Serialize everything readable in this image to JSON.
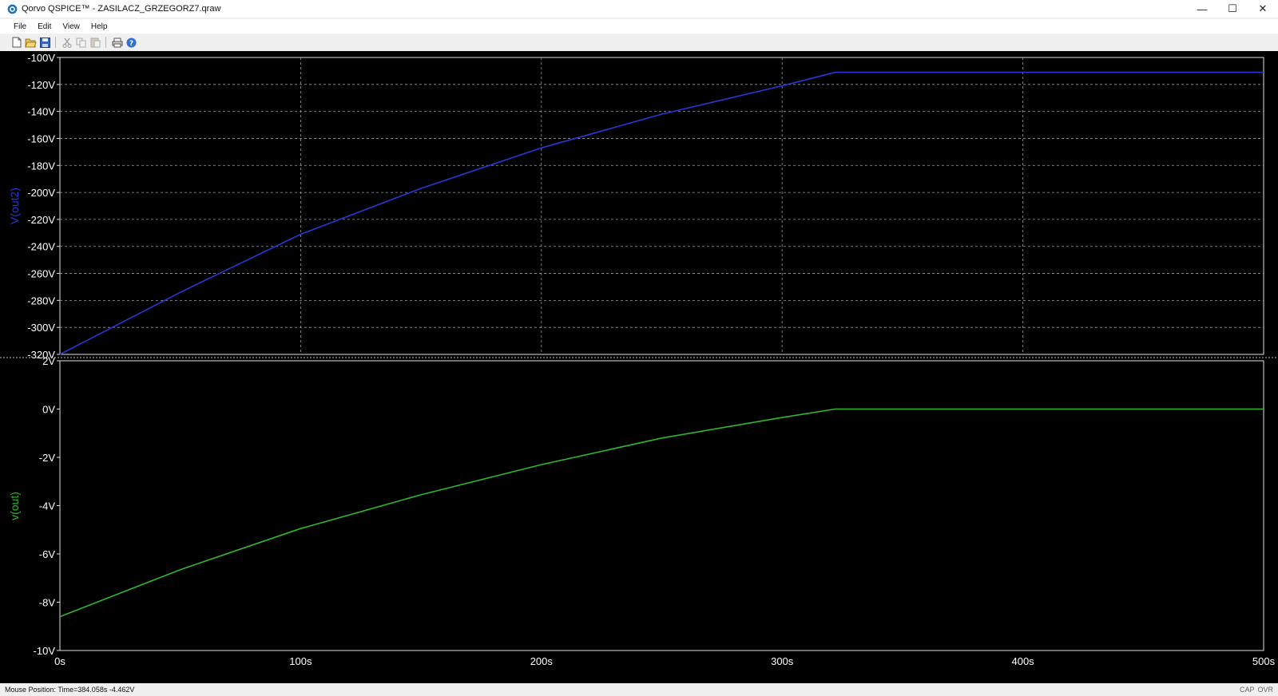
{
  "window": {
    "title": "Qorvo QSPICE™ - ZASILACZ_GRZEGORZ7.qraw",
    "controls": {
      "minimize": "—",
      "maximize": "☐",
      "close": "✕"
    }
  },
  "menu": [
    "File",
    "Edit",
    "View",
    "Help"
  ],
  "toolbar": {
    "icons": [
      "new-file-icon",
      "open-folder-icon",
      "save-icon",
      "cut-icon",
      "copy-icon",
      "paste-icon",
      "print-icon",
      "help-icon"
    ]
  },
  "status": {
    "mouse_position": "Mouse Position: Time=384.058s  -4.462V",
    "cap": "CAP",
    "ovr": "OVR"
  },
  "colors": {
    "plot_background": "#000000",
    "grid": "#9a9a9a",
    "axis_text": "#ffffff",
    "trace_vout2": "#2c35d6",
    "trace_vout": "#2fb52f"
  },
  "chart_data": [
    {
      "type": "line",
      "ylabel": "V(out2)",
      "ylim": [
        -320,
        -100
      ],
      "yticks": [
        "-100V",
        "-120V",
        "-140V",
        "-160V",
        "-180V",
        "-200V",
        "-220V",
        "-240V",
        "-260V",
        "-280V",
        "-300V",
        "-320V"
      ],
      "ytick_values": [
        -100,
        -120,
        -140,
        -160,
        -180,
        -200,
        -220,
        -240,
        -260,
        -280,
        -300,
        -320
      ],
      "xlim": [
        0,
        500
      ],
      "xtick_values": [
        0,
        100,
        200,
        300,
        400,
        500
      ],
      "grid": true,
      "series": [
        {
          "name": "V(out2)",
          "x": [
            0,
            50,
            100,
            150,
            200,
            250,
            300,
            322,
            400,
            500
          ],
          "y": [
            -320,
            -274,
            -231,
            -197,
            -167,
            -142,
            -121,
            -111,
            -111,
            -111
          ]
        }
      ]
    },
    {
      "type": "line",
      "ylabel": "v(out)",
      "ylim": [
        -10,
        2
      ],
      "yticks": [
        "2V",
        "0V",
        "-2V",
        "-4V",
        "-6V",
        "-8V",
        "-10V"
      ],
      "ytick_values": [
        2,
        0,
        -2,
        -4,
        -6,
        -8,
        -10
      ],
      "xlabel": "",
      "xlim": [
        0,
        500
      ],
      "xticks": [
        "0s",
        "100s",
        "200s",
        "300s",
        "400s",
        "500s"
      ],
      "xtick_values": [
        0,
        100,
        200,
        300,
        400,
        500
      ],
      "grid": false,
      "series": [
        {
          "name": "v(out)",
          "x": [
            0,
            50,
            100,
            150,
            200,
            250,
            300,
            322,
            400,
            500
          ],
          "y": [
            -8.6,
            -6.65,
            -4.95,
            -3.55,
            -2.3,
            -1.2,
            -0.35,
            0,
            0,
            0
          ]
        }
      ]
    }
  ]
}
